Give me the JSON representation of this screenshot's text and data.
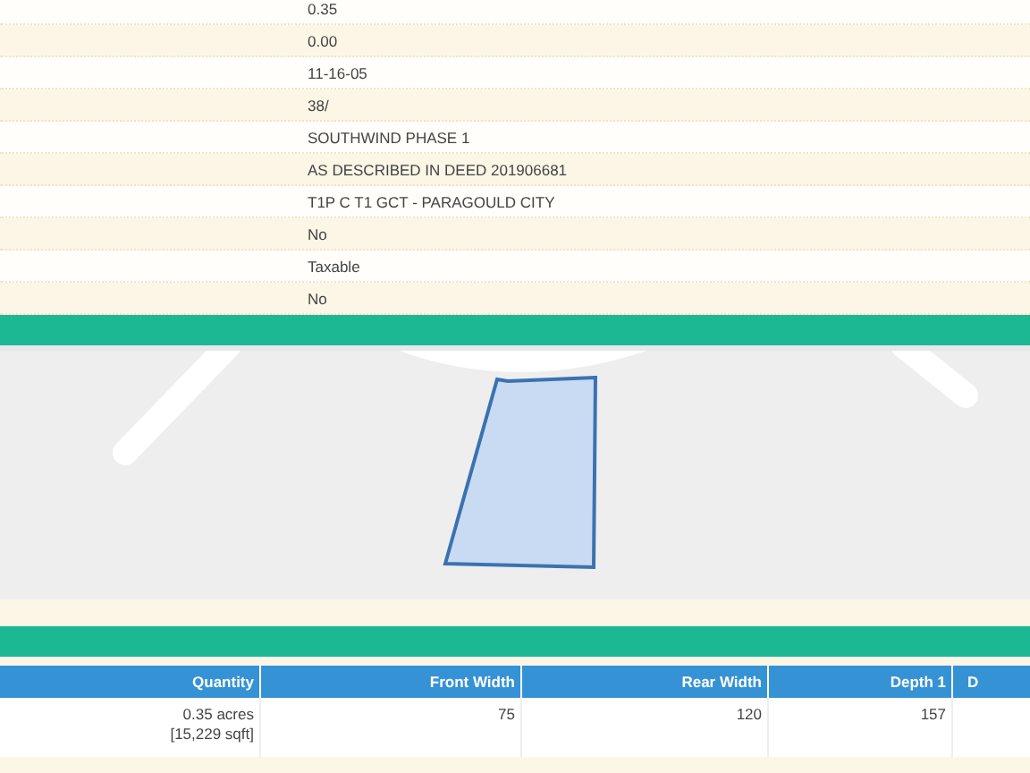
{
  "details": {
    "values": [
      "0.35",
      "0.00",
      "11-16-05",
      "38/",
      "SOUTHWIND PHASE 1",
      "AS DESCRIBED IN DEED 201906681",
      "T1P C T1 GCT - PARAGOULD CITY",
      "No",
      "Taxable",
      "No"
    ]
  },
  "table": {
    "columns": [
      "Quantity",
      "Front Width",
      "Rear Width",
      "Depth 1",
      "D"
    ],
    "rows": [
      {
        "cells": [
          [
            "0.35 acres",
            "[15,229 sqft]"
          ],
          [
            "75"
          ],
          [
            "120"
          ],
          [
            "157"
          ],
          []
        ]
      }
    ]
  }
}
